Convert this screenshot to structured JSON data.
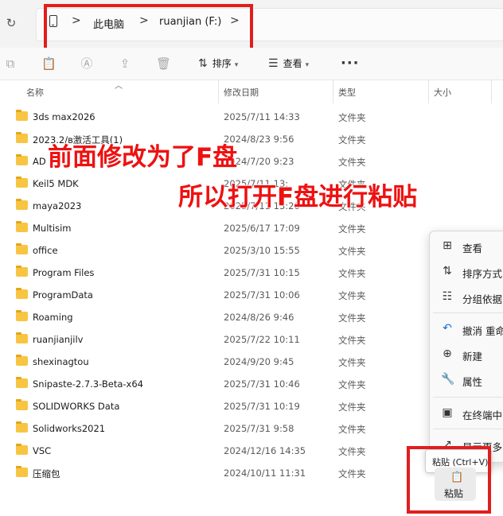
{
  "address_bar": {
    "breadcrumbs": [
      "此电脑",
      "ruanjian (F:)"
    ],
    "separator": ">"
  },
  "toolbar": {
    "sort_label": "排序",
    "view_label": "查看",
    "more_label": "···"
  },
  "columns": {
    "name": "名称",
    "date": "修改日期",
    "type": "类型",
    "size": "大小"
  },
  "files": [
    {
      "name": "3ds max2026",
      "date": "2025/7/11 14:33",
      "type": "文件夹"
    },
    {
      "name": "2023.2/ʙ激活工具(1)",
      "date": "2024/8/23 9:56",
      "type": "文件夹"
    },
    {
      "name": "AD",
      "date": "2024/7/20 9:23",
      "type": "文件夹"
    },
    {
      "name": "Keil5 MDK",
      "date": "2025/7/11 13:",
      "type": "文件夹"
    },
    {
      "name": "maya2023",
      "date": "2025/7/11 13:20",
      "type": "文件夹"
    },
    {
      "name": "Multisim",
      "date": "2025/6/17 17:09",
      "type": "文件夹"
    },
    {
      "name": "office",
      "date": "2025/3/10 15:55",
      "type": "文件夹"
    },
    {
      "name": "Program Files",
      "date": "2025/7/31 10:15",
      "type": "文件夹"
    },
    {
      "name": "ProgramData",
      "date": "2025/7/31 10:06",
      "type": "文件夹"
    },
    {
      "name": "Roaming",
      "date": "2024/8/26 9:46",
      "type": "文件夹"
    },
    {
      "name": "ruanjianjilv",
      "date": "2025/7/22 10:11",
      "type": "文件夹"
    },
    {
      "name": "shexinagtou",
      "date": "2024/9/20 9:45",
      "type": "文件夹"
    },
    {
      "name": "Snipaste-2.7.3-Beta-x64",
      "date": "2025/7/31 10:46",
      "type": "文件夹"
    },
    {
      "name": "SOLIDWORKS Data",
      "date": "2025/7/31 10:19",
      "type": "文件夹"
    },
    {
      "name": "Solidworks2021",
      "date": "2025/7/31 9:58",
      "type": "文件夹"
    },
    {
      "name": "VSC",
      "date": "2024/12/16 14:35",
      "type": "文件夹"
    },
    {
      "name": "压缩包",
      "date": "2024/10/11 11:31",
      "type": "文件夹"
    }
  ],
  "annotations": {
    "line1": "前面修改为了F盘",
    "line2": "所以打开F盘进行粘贴"
  },
  "context_menu": {
    "items": [
      {
        "label": "查看",
        "icon": "grid-icon"
      },
      {
        "label": "排序方式",
        "icon": "sort-icon"
      },
      {
        "label": "分组依据",
        "icon": "group-icon"
      },
      {
        "label": "撤消 重命",
        "icon": "undo-icon"
      },
      {
        "label": "新建",
        "icon": "new-icon"
      },
      {
        "label": "属性",
        "icon": "wrench-icon"
      },
      {
        "label": "在终端中",
        "icon": "terminal-icon"
      },
      {
        "label": "显示更多",
        "icon": "share-icon"
      }
    ],
    "tooltip": "粘贴 (Ctrl+V)",
    "paste_label": "粘贴"
  },
  "colors": {
    "highlight_red": "#e01e1e",
    "overlay_text": "#ee1111",
    "folder": "#f7c542",
    "accent_blue": "#1a6fd1"
  }
}
